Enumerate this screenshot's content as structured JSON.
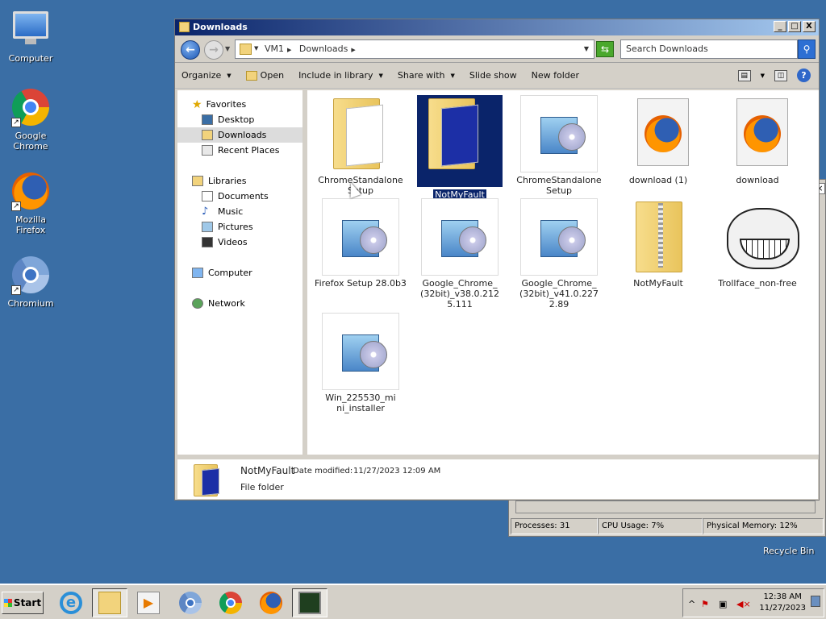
{
  "desktop": {
    "icons": [
      {
        "label": "Computer",
        "icon": "computer-icon"
      },
      {
        "label": "Google Chrome",
        "icon": "chrome-icon"
      },
      {
        "label": "Mozilla Firefox",
        "icon": "firefox-icon"
      },
      {
        "label": "Chromium",
        "icon": "chromium-icon"
      }
    ],
    "recycle_bin": "Recycle Bin"
  },
  "window": {
    "title": "Downloads",
    "controls": {
      "minimize": "_",
      "maximize": "□",
      "close": "X"
    },
    "address": {
      "segments": [
        "VM1",
        "Downloads"
      ]
    },
    "search_placeholder": "Search Downloads",
    "toolbar": {
      "organize": "Organize",
      "open": "Open",
      "include": "Include in library",
      "share": "Share with",
      "slideshow": "Slide show",
      "newfolder": "New folder"
    },
    "nav": {
      "favorites": "Favorites",
      "desktop": "Desktop",
      "downloads": "Downloads",
      "recent": "Recent Places",
      "libraries": "Libraries",
      "documents": "Documents",
      "music": "Music",
      "pictures": "Pictures",
      "videos": "Videos",
      "computer": "Computer",
      "network": "Network"
    },
    "files": [
      {
        "name": "ChromeStandalone Setup",
        "kind": "folder",
        "selected": false
      },
      {
        "name": "NotMyFault",
        "kind": "folder",
        "selected": true
      },
      {
        "name": "ChromeStandalone Setup",
        "kind": "setup",
        "selected": false
      },
      {
        "name": "download (1)",
        "kind": "firefox-doc",
        "selected": false
      },
      {
        "name": "download",
        "kind": "firefox-doc",
        "selected": false
      },
      {
        "name": "Firefox Setup 28.0b3",
        "kind": "setup",
        "selected": false
      },
      {
        "name": "Google_Chrome_(32bit)_v38.0.2125.111",
        "kind": "setup",
        "selected": false
      },
      {
        "name": "Google_Chrome_(32bit)_v41.0.2272.89",
        "kind": "setup",
        "selected": false
      },
      {
        "name": "NotMyFault",
        "kind": "zip",
        "selected": false
      },
      {
        "name": "Trollface_non-free",
        "kind": "image",
        "selected": false
      },
      {
        "name": "Win_225530_mini_installer",
        "kind": "setup",
        "selected": false
      }
    ],
    "details": {
      "name": "NotMyFault",
      "modified_label": "Date modified:",
      "modified": "11/27/2023 12:09 AM",
      "type": "File folder"
    }
  },
  "taskmanager": {
    "processes": "Processes: 31",
    "cpu": "CPU Usage: 7%",
    "memory": "Physical Memory: 12%"
  },
  "taskbar": {
    "start": "Start",
    "time": "12:38 AM",
    "date": "11/27/2023"
  }
}
